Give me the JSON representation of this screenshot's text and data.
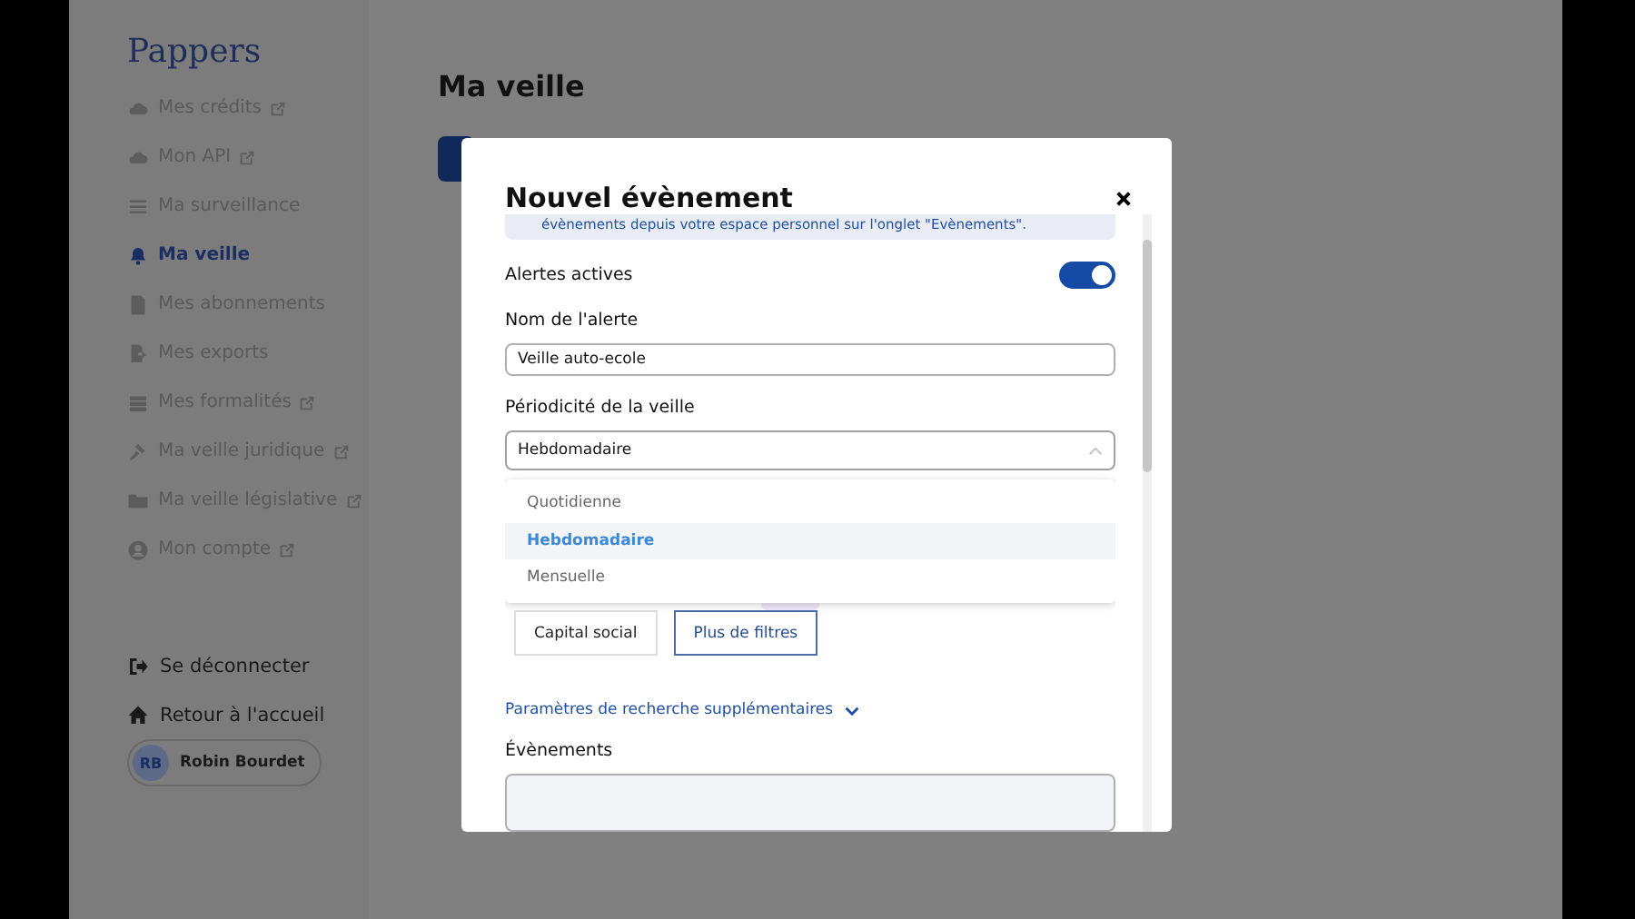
{
  "sidebar": {
    "logo": "Pappers",
    "items": [
      {
        "label": "Mes crédits",
        "external": true,
        "selected": false
      },
      {
        "label": "Mon API",
        "external": true,
        "selected": false
      },
      {
        "label": "Ma surveillance",
        "external": false,
        "selected": false
      },
      {
        "label": "Ma veille",
        "external": false,
        "selected": true
      },
      {
        "label": "Mes abonnements",
        "external": false,
        "selected": false
      },
      {
        "label": "Mes exports",
        "external": false,
        "selected": false
      },
      {
        "label": "Mes formalités",
        "external": true,
        "selected": false
      },
      {
        "label": "Ma veille juridique",
        "external": true,
        "selected": false
      },
      {
        "label": "Ma veille législative",
        "external": true,
        "selected": false
      },
      {
        "label": "Mon compte",
        "external": true,
        "selected": false
      }
    ],
    "bottom": [
      {
        "label": "Se déconnecter"
      },
      {
        "label": "Retour à l'accueil"
      }
    ],
    "user": {
      "initials": "RB",
      "name": "Robin Bourdet"
    }
  },
  "page": {
    "title": "Ma veille"
  },
  "modal": {
    "title": "Nouvel évènement",
    "info": "évènements depuis votre espace personnel sur l'onglet \"Evènements\".",
    "toggle": {
      "label": "Alertes actives",
      "on": true
    },
    "name_field": {
      "label": "Nom de l'alerte",
      "value": "Veille auto-ecole"
    },
    "period": {
      "label": "Périodicité de la veille",
      "value": "Hebdomadaire",
      "expanded": true,
      "options": [
        {
          "label": "Quotidienne",
          "selected": false
        },
        {
          "label": "Hebdomadaire",
          "selected": true
        },
        {
          "label": "Mensuelle",
          "selected": false
        }
      ]
    },
    "filters": [
      {
        "label": "Capital social",
        "active": false
      },
      {
        "label": "Plus de filtres",
        "active": true
      }
    ],
    "more_link": "Paramètres de recherche supplémentaires",
    "events_label": "Évènements"
  }
}
